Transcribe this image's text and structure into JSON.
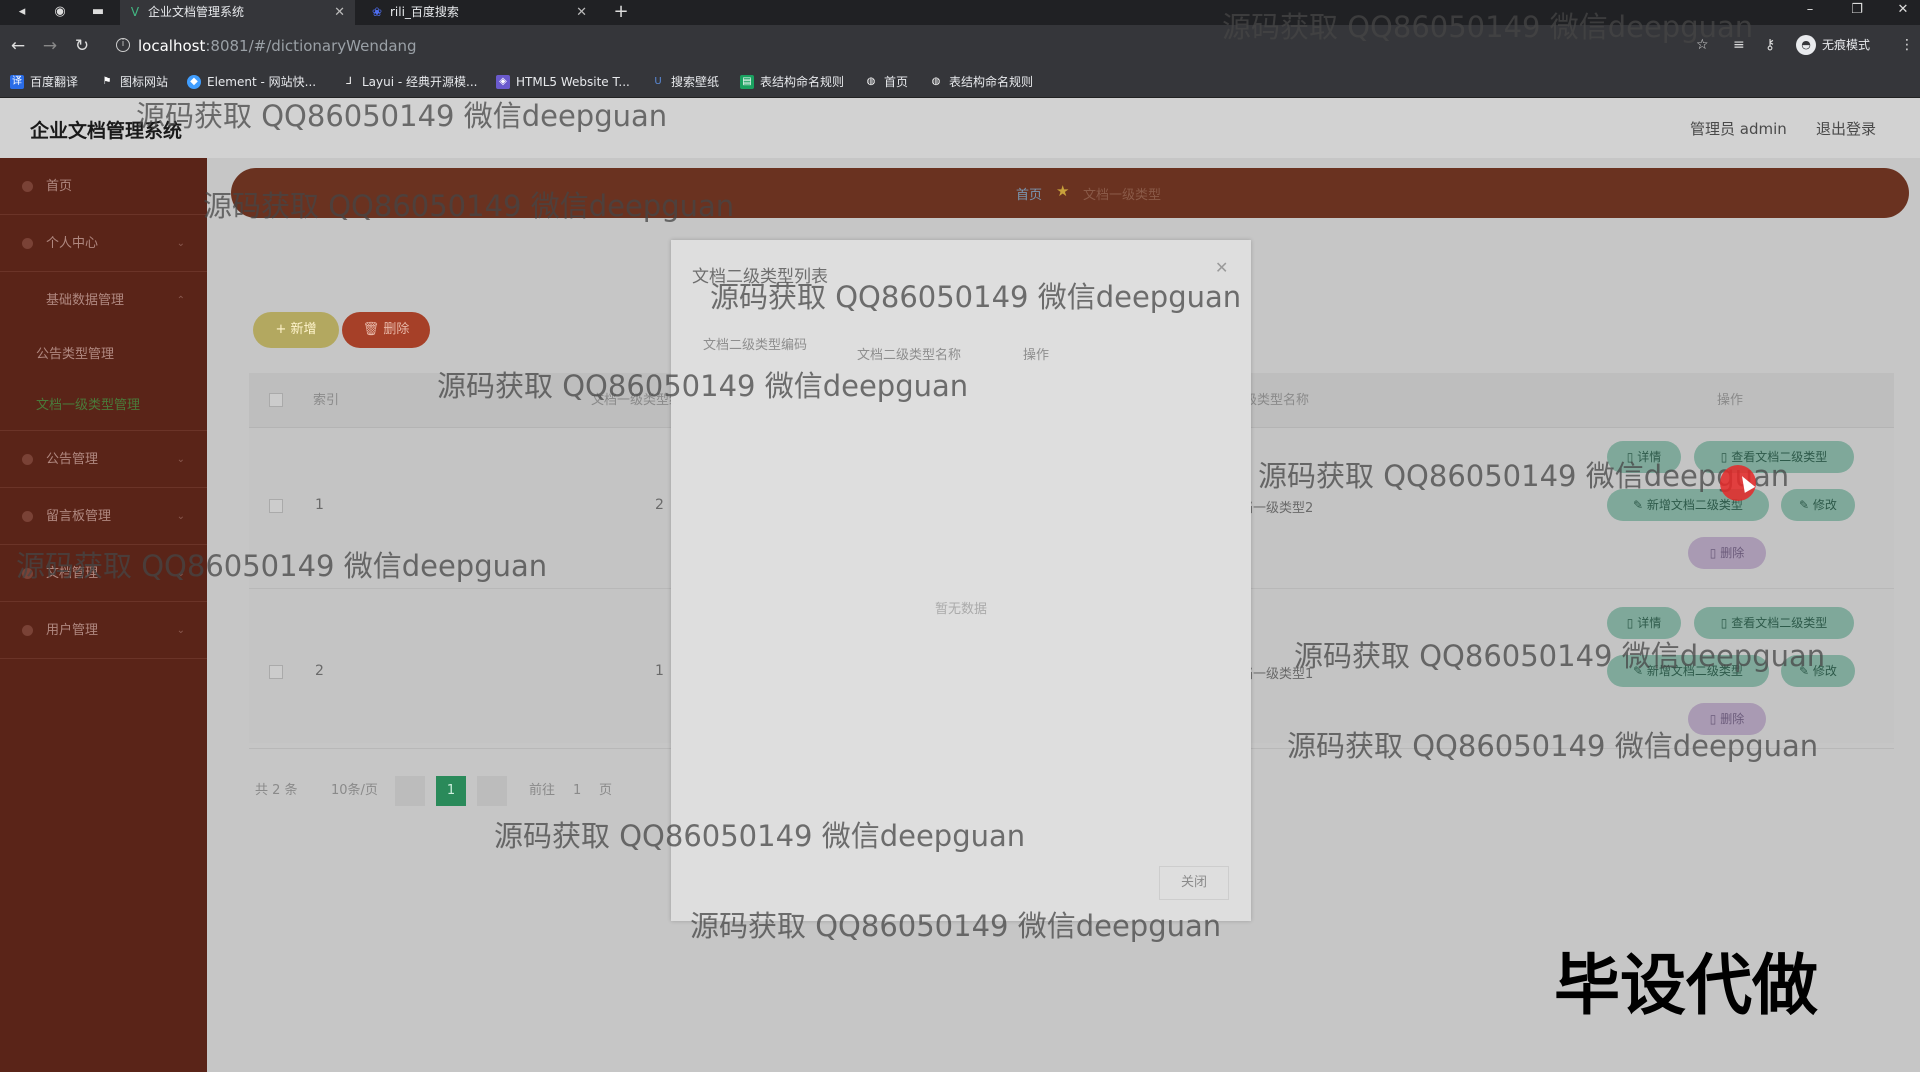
{
  "browser": {
    "tabs": [
      {
        "title": "企业文档管理系统",
        "icon": "vue-logo-icon"
      },
      {
        "title": "rili_百度搜索",
        "icon": "baidu-paw-icon"
      }
    ],
    "url_host": "localhost",
    "url_path": ":8081/#/dictionaryWendang",
    "incognito_label": "无痕模式",
    "bookmarks": [
      "百度翻译",
      "图标网站",
      "Element - 网站快...",
      "Layui - 经典开源模...",
      "HTML5 Website T...",
      "搜索壁纸",
      "表结构命名规则",
      "首页",
      "表结构命名规则"
    ]
  },
  "header": {
    "title": "企业文档管理系统",
    "user": "管理员 admin",
    "logout": "退出登录"
  },
  "sidebar": {
    "items": [
      {
        "label": "首页"
      },
      {
        "label": "个人中心"
      },
      {
        "label": "基础数据管理"
      },
      {
        "label": "公告类型管理"
      },
      {
        "label": "文档一级类型管理"
      },
      {
        "label": "公告管理"
      },
      {
        "label": "留言板管理"
      },
      {
        "label": "文档管理"
      },
      {
        "label": "用户管理"
      }
    ]
  },
  "breadcrumb": {
    "home": "首页",
    "current": "文档一级类型"
  },
  "toolbar": {
    "add": "新增",
    "delete": "删除"
  },
  "table": {
    "headers": [
      "索引",
      "文档一级类型编码",
      "文档一级类型名称",
      "操作"
    ],
    "rows": [
      {
        "index": "1",
        "code": "2",
        "name": "文档一级类型2"
      },
      {
        "index": "2",
        "code": "1",
        "name": "文档一级类型1"
      }
    ],
    "actions": {
      "detail": "详情",
      "view_sub": "查看文档二级类型",
      "add_sub": "新增文档二级类型",
      "edit": "修改",
      "delete": "删除"
    }
  },
  "pager": {
    "total": "共 2 条",
    "size": "10条/页",
    "current": "1",
    "goto": "前往",
    "goto_page": "1",
    "page_suffix": "页"
  },
  "modal": {
    "title": "文档二级类型列表",
    "col_code": "文档二级类型编码",
    "col_name": "文档二级类型名称",
    "col_ops": "操作",
    "empty": "暂无数据",
    "close": "关闭"
  },
  "watermark": {
    "text": "源码获取 QQ86050149 微信deepguan",
    "corner": "毕设代做"
  }
}
